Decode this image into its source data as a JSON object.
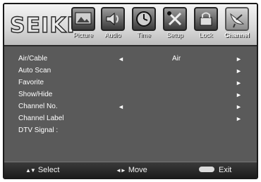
{
  "brand": "SEIKI",
  "tabs": [
    {
      "label": "Picture",
      "icon": "picture-icon"
    },
    {
      "label": "Audio",
      "icon": "audio-icon"
    },
    {
      "label": "Time",
      "icon": "clock-icon"
    },
    {
      "label": "Setup",
      "icon": "setup-icon"
    },
    {
      "label": "Lock",
      "icon": "lock-icon"
    },
    {
      "label": "Channel",
      "icon": "satellite-dish-icon",
      "active": true
    }
  ],
  "menu": [
    {
      "label": "Air/Cable",
      "left_arrow": "◄",
      "value": "Air",
      "right_arrow": "►"
    },
    {
      "label": "Auto Scan",
      "left_arrow": "",
      "value": "",
      "right_arrow": "►"
    },
    {
      "label": "Favorite",
      "left_arrow": "",
      "value": "",
      "right_arrow": "►"
    },
    {
      "label": "Show/Hide",
      "left_arrow": "",
      "value": "",
      "right_arrow": "►"
    },
    {
      "label": "Channel No.",
      "left_arrow": "◄",
      "value": "",
      "right_arrow": "►"
    },
    {
      "label": "Channel Label",
      "left_arrow": "",
      "value": "",
      "right_arrow": "►"
    },
    {
      "label": "DTV Signal :",
      "left_arrow": "",
      "value": "",
      "right_arrow": ""
    }
  ],
  "footer": {
    "select_glyph": "▲▼",
    "select_label": "Select",
    "move_glyph": "◄►",
    "move_label": "Move",
    "exit_label": "Exit"
  }
}
